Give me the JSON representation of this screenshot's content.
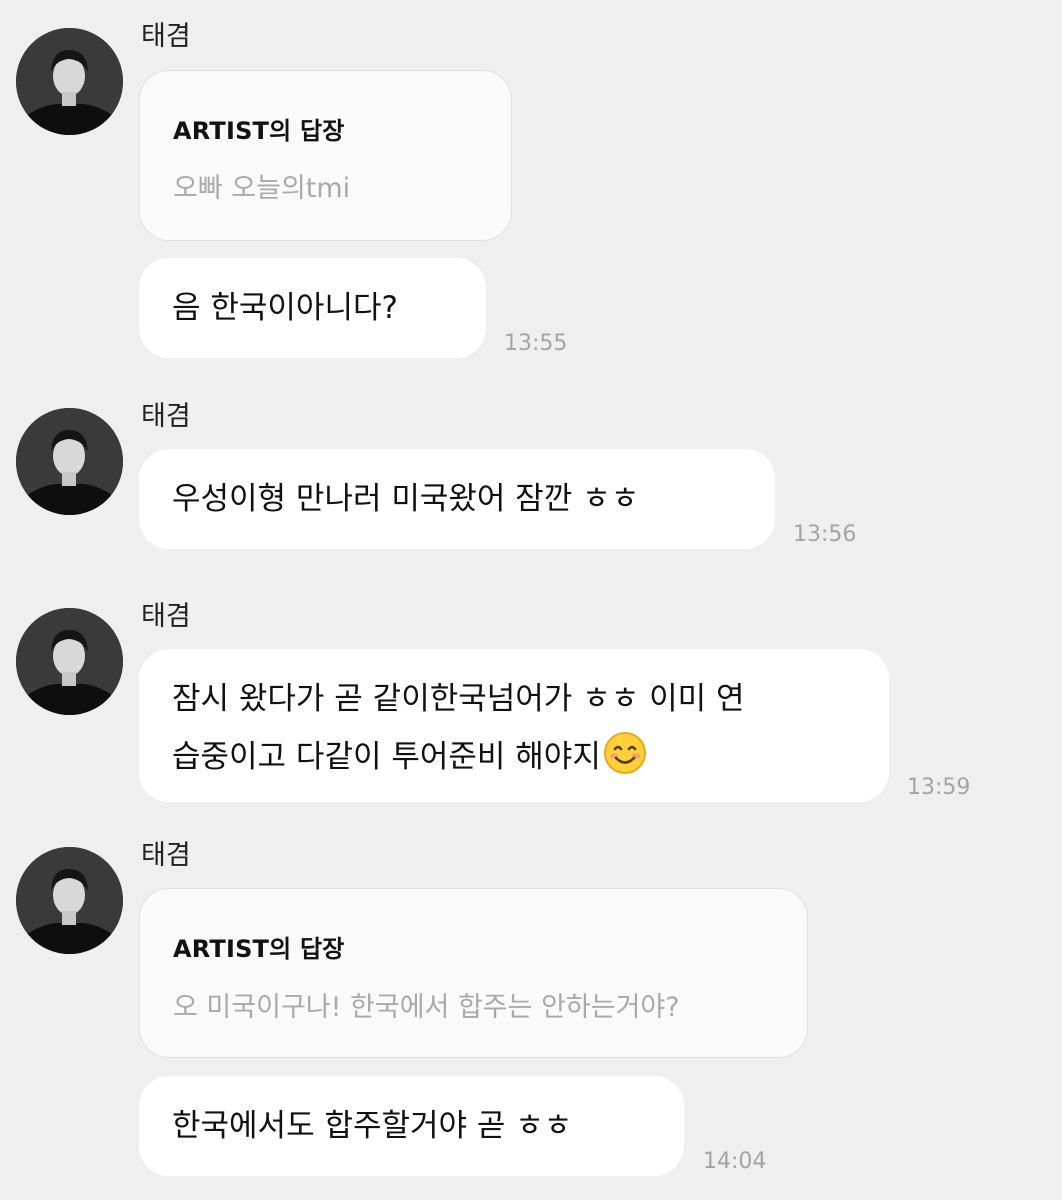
{
  "messages": [
    {
      "sender": "태겸",
      "reply": {
        "title": "ARTIST의 답장",
        "quote": "오빠 오늘의tmi"
      },
      "text": "음 한국이아니다?",
      "time": "13:55"
    },
    {
      "sender": "태겸",
      "text": "우성이형 만나러 미국왔어 잠깐 ㅎㅎ",
      "time": "13:56"
    },
    {
      "sender": "태겸",
      "line1": "잠시 왔다가 곧 같이한국넘어가 ㅎㅎ 이미 연",
      "line2": "습중이고 다같이 투어준비 해야지",
      "emoji": "smiling-face-emoji",
      "time": "13:59"
    },
    {
      "sender": "태겸",
      "reply": {
        "title": "ARTIST의 답장",
        "quote": "오 미국이구나! 한국에서 합주는 안하는거야?"
      },
      "text": "한국에서도 합주할거야 곧 ㅎㅎ",
      "time": "14:04"
    }
  ]
}
